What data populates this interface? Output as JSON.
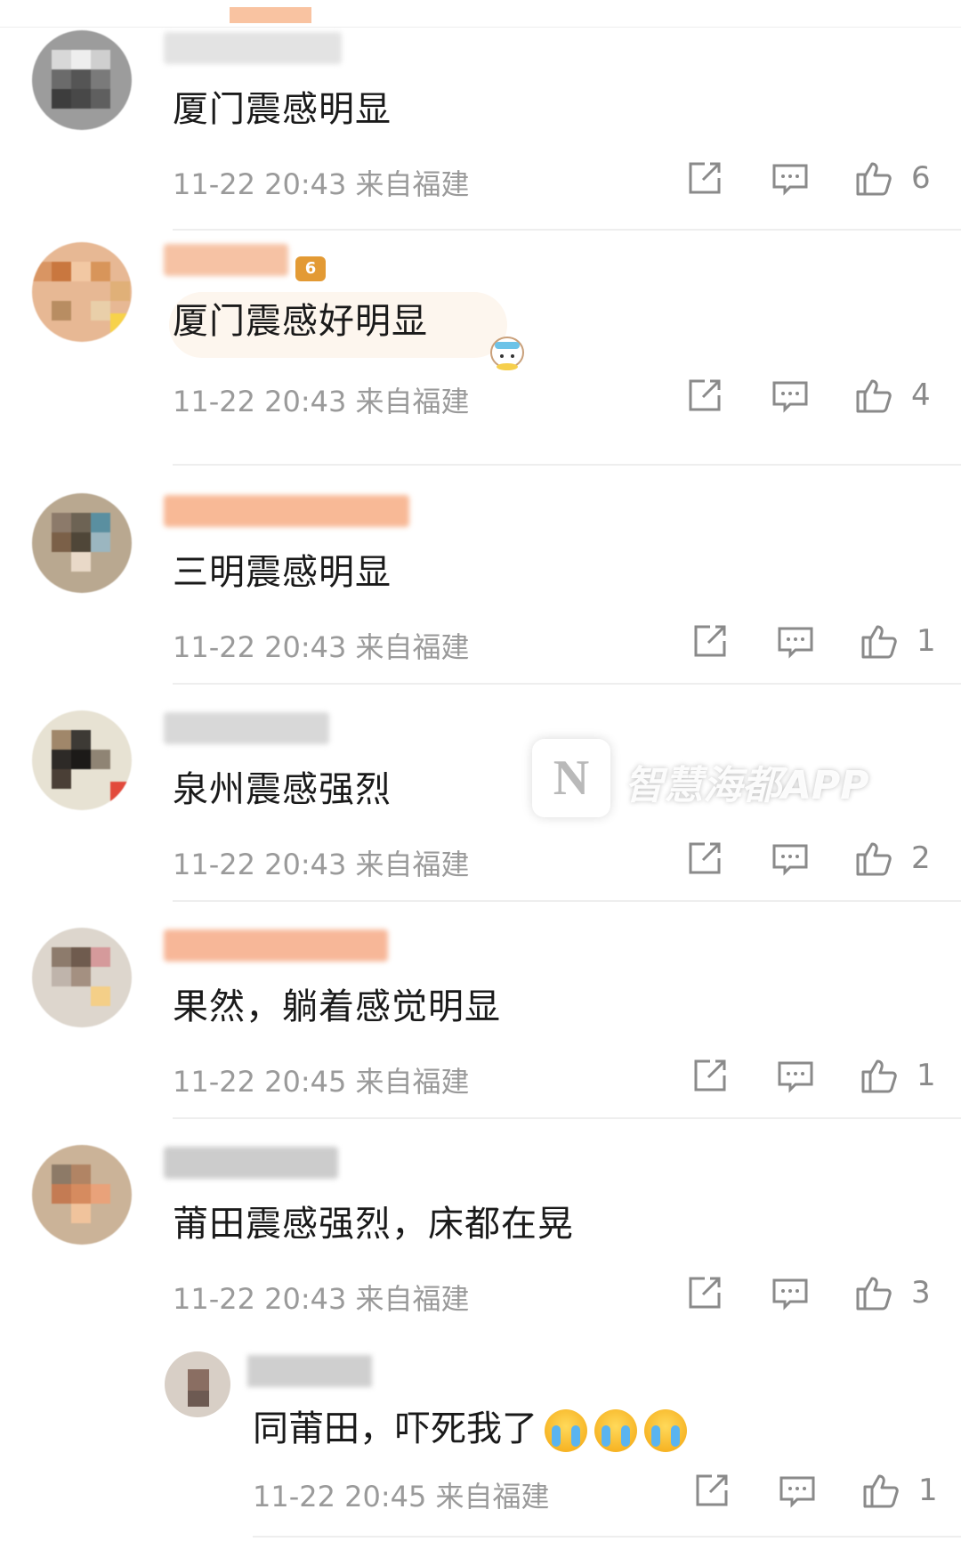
{
  "comments": [
    {
      "text": "厦门震感明显",
      "meta": "11-22 20:43 来自福建",
      "likes": "6"
    },
    {
      "text": "厦门震感好明显",
      "meta": "11-22 20:43 来自福建",
      "likes": "4",
      "badge": "6"
    },
    {
      "text": "三明震感明显",
      "meta": "11-22 20:43 来自福建",
      "likes": "1"
    },
    {
      "text": "泉州震感强烈",
      "meta": "11-22 20:43 来自福建",
      "likes": "2"
    },
    {
      "text": "果然，躺着感觉明显",
      "meta": "11-22 20:45 来自福建",
      "likes": "1"
    },
    {
      "text": "莆田震感强烈，床都在晃",
      "meta": "11-22 20:43 来自福建",
      "likes": "3"
    }
  ],
  "reply": {
    "text": "同莆田，吓死我了",
    "meta": "11-22 20:45 来自福建",
    "likes": "1"
  },
  "watermark": {
    "logo": "N",
    "text": "智慧海都APP"
  },
  "icons": {
    "share": "share-icon",
    "comment": "comment-icon",
    "like": "thumbs-up-icon",
    "cry": "crying-emoji-icon"
  }
}
